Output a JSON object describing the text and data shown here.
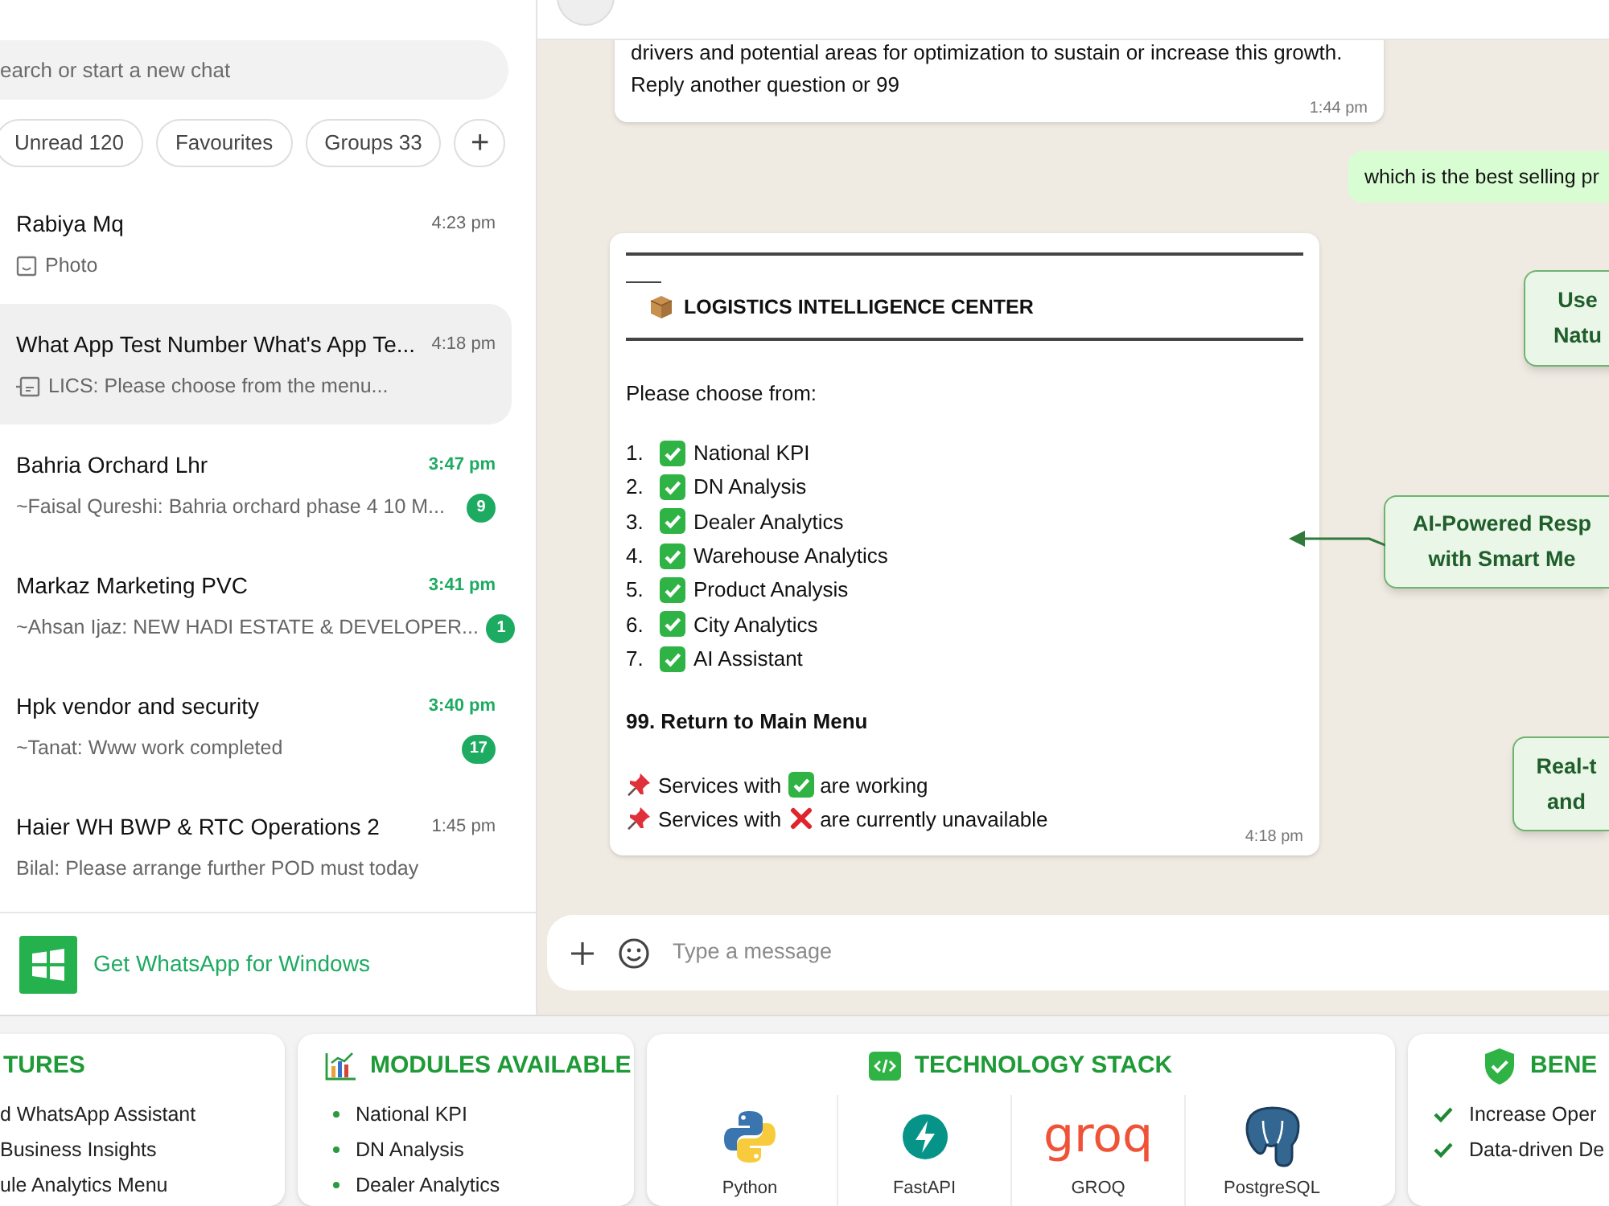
{
  "search": {
    "placeholder": "earch or start a new chat"
  },
  "filters": [
    {
      "label": "Unread 120"
    },
    {
      "label": "Favourites"
    },
    {
      "label": "Groups 33"
    },
    {
      "label": "+"
    }
  ],
  "chats": [
    {
      "name": "Rabiya Mq",
      "time": "4:23 pm",
      "preview": "Photo",
      "kind": "photo",
      "selected": false
    },
    {
      "name": "What App Test Number What's App Te...",
      "time": "4:18 pm",
      "preview": "LICS: Please choose from the menu...",
      "kind": "document",
      "selected": true
    },
    {
      "name": "Bahria Orchard Lhr",
      "time": "3:47 pm",
      "preview": "~Faisal Qureshi: Bahria orchard phase 4 10 M...",
      "kind": "text",
      "unread": "9",
      "selected": false
    },
    {
      "name": "Markaz Marketing PVC",
      "time": "3:41 pm",
      "preview": "~Ahsan Ijaz: NEW HADI ESTATE & DEVELOPER...",
      "kind": "text",
      "unread": "1",
      "selected": false
    },
    {
      "name": "Hpk vendor and security",
      "time": "3:40 pm",
      "preview": "~Tanat: Www work completed",
      "kind": "text",
      "unread": "17",
      "selected": false
    },
    {
      "name": "Haier WH BWP & RTC Operations 2",
      "time": "1:45 pm",
      "preview": "Bilal: Please arrange further POD must today",
      "kind": "text",
      "selected": false
    }
  ],
  "get_app": {
    "label": "Get WhatsApp for Windows"
  },
  "messages": [
    {
      "kind": "incoming",
      "text": "drivers and potential areas for optimization to sustain or increase this growth.\nReply another question or 99",
      "time": "1:44 pm"
    },
    {
      "kind": "outgoing",
      "text": "which is the best selling pr"
    },
    {
      "kind": "menu",
      "title": "LOGISTICS INTELLIGENCE CENTER",
      "prompt": "Please choose from:",
      "options": [
        {
          "number": "1.",
          "label": "National KPI",
          "available": true
        },
        {
          "number": "2.",
          "label": "DN Analysis",
          "available": true
        },
        {
          "number": "3.",
          "label": "Dealer Analytics",
          "available": true
        },
        {
          "number": "4.",
          "label": "Warehouse Analytics",
          "available": true
        },
        {
          "number": "5.",
          "label": "Product Analysis",
          "available": true
        },
        {
          "number": "6.",
          "label": "City Analytics",
          "available": true
        },
        {
          "number": "7.",
          "label": "AI Assistant",
          "available": true
        }
      ],
      "return_option": "99. Return to Main Menu",
      "legend": [
        {
          "before": "Services with",
          "available": true,
          "after": "are working"
        },
        {
          "before": "Services with",
          "available": false,
          "after": "are currently unavailable"
        }
      ],
      "time": "4:18 pm"
    }
  ],
  "composer": {
    "placeholder": "Type a message"
  },
  "callouts": [
    {
      "text": "Use\nNatu",
      "arrow": false
    },
    {
      "text": "AI-Powered Resp\nwith Smart Me",
      "arrow": true
    },
    {
      "text": "Real-t\nand",
      "arrow": false
    }
  ],
  "panels": [
    {
      "kind": "features",
      "title": "TURES",
      "items": [
        "d WhatsApp Assistant",
        "Business Insights",
        "ule Analytics Menu"
      ]
    },
    {
      "kind": "modules",
      "title": "MODULES AVAILABLE",
      "items": [
        "National KPI",
        "DN Analysis",
        "Dealer Analytics"
      ]
    },
    {
      "kind": "tech",
      "title": "TECHNOLOGY STACK",
      "items": [
        {
          "label": "Python",
          "kind": "python"
        },
        {
          "label": "FastAPI",
          "kind": "fastapi"
        },
        {
          "label": "GROQ",
          "kind": "wordmark",
          "wordmark": "groq"
        },
        {
          "label": "PostgreSQL",
          "kind": "postgres"
        }
      ]
    },
    {
      "kind": "benefits",
      "title": "BENE",
      "items": [
        "Increase Oper",
        "Data-driven De"
      ]
    }
  ]
}
